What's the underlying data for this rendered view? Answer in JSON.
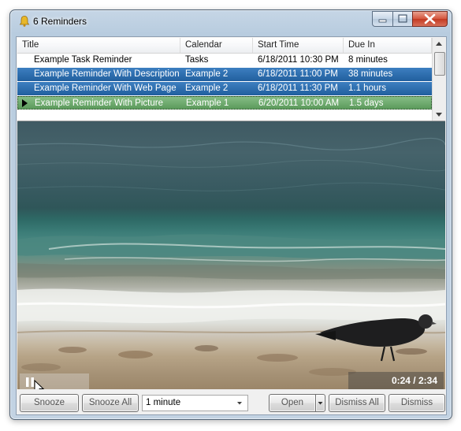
{
  "window": {
    "title": "6 Reminders"
  },
  "icons": {
    "app": "bell-icon",
    "minimize": "minimize-icon",
    "maximize": "maximize-icon",
    "close": "close-icon",
    "current_row": "row-pointer-icon",
    "pause": "pause-icon",
    "cursor": "mouse-cursor-icon"
  },
  "list": {
    "columns": [
      "Title",
      "Calendar",
      "Start Time",
      "Due In"
    ],
    "rows": [
      {
        "title": "Example Task Reminder",
        "calendar": "Tasks",
        "start": "6/18/2011 10:30 PM",
        "due": "8 minutes",
        "state": "normal"
      },
      {
        "title": "Example Reminder With Description",
        "calendar": "Example 2",
        "start": "6/18/2011 11:00 PM",
        "due": "38 minutes",
        "state": "selected"
      },
      {
        "title": "Example Reminder With Web Page",
        "calendar": "Example 2",
        "start": "6/18/2011 11:30 PM",
        "due": "1.1 hours",
        "state": "selected"
      },
      {
        "title": "Example Reminder With Picture",
        "calendar": "Example 1",
        "start": "6/20/2011 10:00 AM",
        "due": "1.5 days",
        "state": "current"
      }
    ]
  },
  "video": {
    "time": "0:24 / 2:34"
  },
  "buttons": {
    "snooze": "Snooze",
    "snooze_all": "Snooze All",
    "snooze_duration": "1 minute",
    "open": "Open",
    "dismiss_all": "Dismiss All",
    "dismiss": "Dismiss"
  },
  "colors": {
    "selected_row": "#2c6aa8",
    "current_row": "#6aa86a",
    "close_button": "#c9452c"
  }
}
